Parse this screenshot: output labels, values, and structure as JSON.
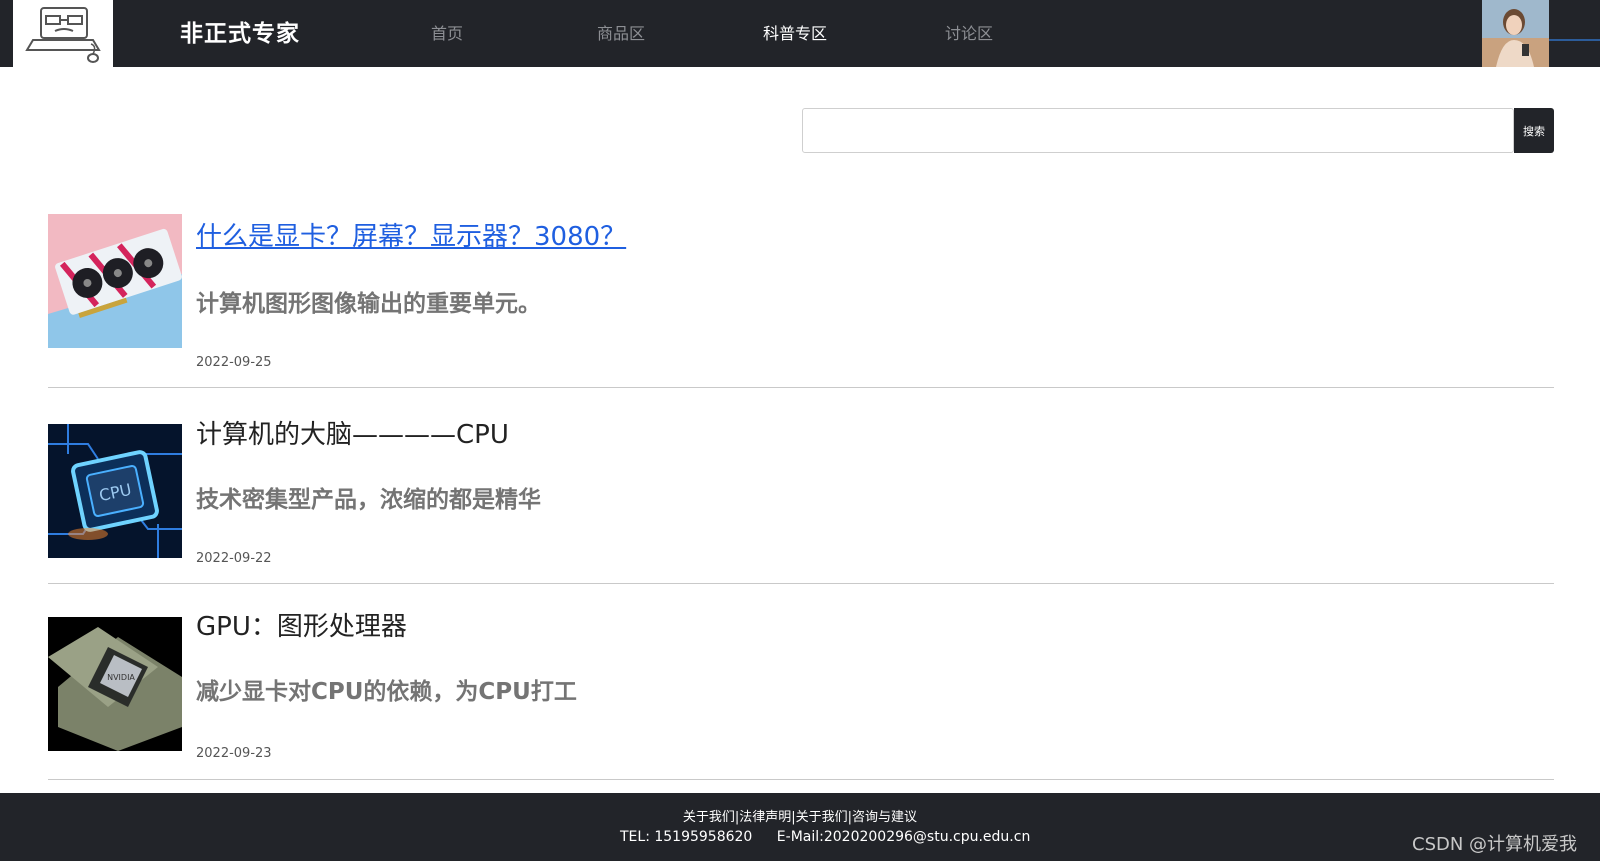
{
  "header": {
    "brand": "非正式专家",
    "nav": [
      {
        "label": "首页",
        "active": false
      },
      {
        "label": "商品区",
        "active": false
      },
      {
        "label": "科普专区",
        "active": true
      },
      {
        "label": "讨论区",
        "active": false
      }
    ]
  },
  "search": {
    "placeholder": "",
    "button_label": "搜索"
  },
  "articles": [
    {
      "title": "什么是显卡？屏幕？显示器？3080？",
      "summary": "计算机图形图像输出的重要单元。",
      "date": "2022-09-25",
      "is_link": true,
      "thumb_icon": "graphics-card-image"
    },
    {
      "title": "计算机的大脑————CPU",
      "summary": "技术密集型产品，浓缩的都是精华",
      "date": "2022-09-22",
      "is_link": false,
      "thumb_icon": "cpu-chip-image"
    },
    {
      "title": "GPU：图形处理器",
      "summary": "减少显卡对CPU的依赖，为CPU打工",
      "date": "2022-09-23",
      "is_link": false,
      "thumb_icon": "gpu-chip-image"
    }
  ],
  "footer": {
    "links": "关于我们|法律声明|关于我们|咨询与建议",
    "tel": "TEL: 15195958620",
    "email": "E-Mail:2020200296@stu.cpu.edu.cn"
  },
  "watermark": "CSDN @计算机爱我",
  "colors": {
    "header_bg": "#222429",
    "link": "#1f5fe0",
    "summary": "#747474"
  }
}
